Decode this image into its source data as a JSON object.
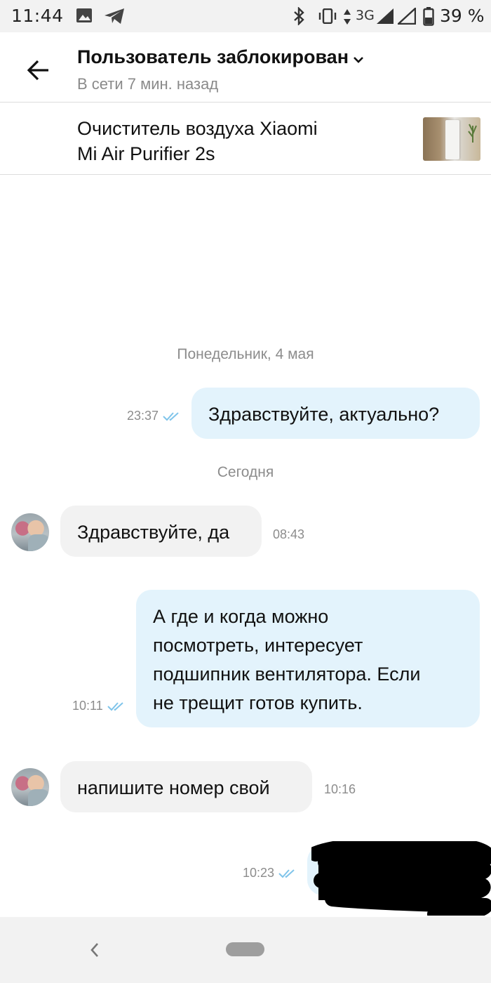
{
  "status_bar": {
    "time": "11:44",
    "network": "3G",
    "battery": "39 %",
    "icons": [
      "gallery-icon",
      "telegram-icon",
      "bluetooth-icon",
      "vibrate-icon",
      "data-arrows-icon",
      "signal-icon",
      "signal-icon",
      "battery-icon"
    ]
  },
  "header": {
    "back_icon": "arrow-left-icon",
    "title": "Пользователь заблокирован",
    "dropdown_icon": "chevron-down-icon",
    "subtitle": "В сети 7 мин. назад"
  },
  "product": {
    "line1": "Очиститель воздуха Xiaomi",
    "line2": "Mi Air Purifier 2s"
  },
  "chat": {
    "date_1": "Понедельник, 4 мая",
    "date_2": "Сегодня",
    "messages": [
      {
        "direction": "out",
        "text": "Здравствуйте, актуально?",
        "time": "23:37",
        "status": "read"
      },
      {
        "direction": "in",
        "text": "Здравствуйте, да",
        "time": "08:43"
      },
      {
        "direction": "out",
        "lines": [
          "А где и когда можно",
          "посмотреть, интересует",
          "подшипник вентилятора. Если",
          "не трещит готов купить."
        ],
        "time": "10:11",
        "status": "read"
      },
      {
        "direction": "in",
        "text": "напишите номер свой",
        "time": "10:16"
      },
      {
        "direction": "out",
        "text": "",
        "time": "10:23",
        "status": "read",
        "redacted": true
      }
    ]
  },
  "colors": {
    "outgoing_bubble": "#e3f3fc",
    "incoming_bubble": "#f2f2f2",
    "read_ticks": "#7fc4ea",
    "muted_text": "#8c8c8c"
  },
  "nav_bar": {
    "back_icon": "chevron-left-icon",
    "home_icon": "home-pill-icon"
  }
}
